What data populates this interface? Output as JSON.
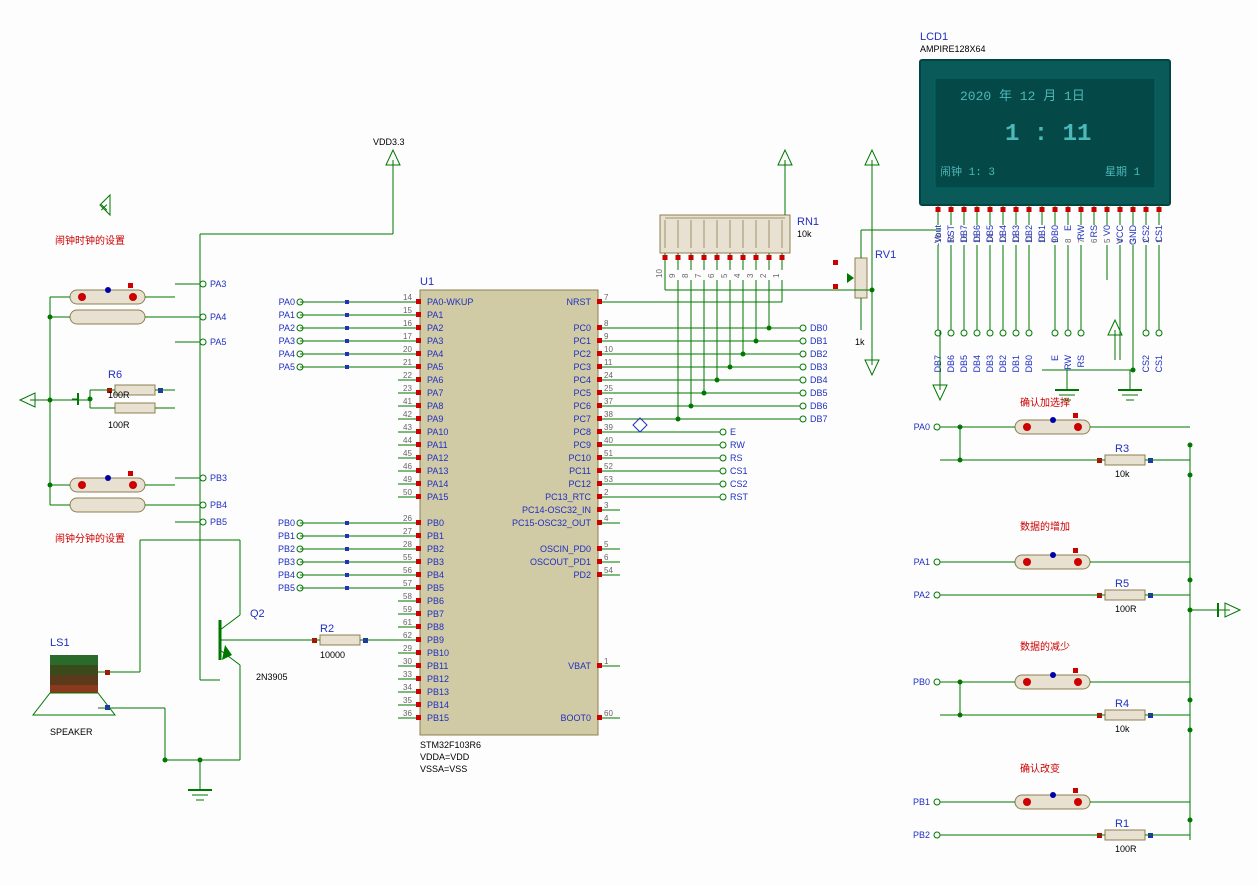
{
  "labels": {
    "section_alarm_hour": "闹钟时钟的设置",
    "section_alarm_min": "闹钟分钟的设置",
    "section_confirm_select": "确认加选择",
    "section_data_inc": "数据的增加",
    "section_data_dec": "数据的减少",
    "section_confirm_change": "确认改变",
    "vdd": "VDD3.3"
  },
  "components": {
    "U1": {
      "ref": "U1",
      "value": "STM32F103R6",
      "vdda": "VDDA=VDD",
      "vssa": "VSSA=VSS"
    },
    "LCD1": {
      "ref": "LCD1",
      "value": "AMPIRE128X64"
    },
    "RN1": {
      "ref": "RN1",
      "value": "10k"
    },
    "RV1": {
      "ref": "RV1",
      "value": "1k"
    },
    "R1": {
      "ref": "R1",
      "value": "100R"
    },
    "R2": {
      "ref": "R2",
      "value": "10000"
    },
    "R3": {
      "ref": "R3",
      "value": "10k"
    },
    "R4": {
      "ref": "R4",
      "value": "10k"
    },
    "R5": {
      "ref": "R5",
      "value": "100R"
    },
    "R6": {
      "ref": "R6",
      "value": "100R",
      "extra": "100R"
    },
    "Q2": {
      "ref": "Q2",
      "value": "2N3905"
    },
    "LS1": {
      "ref": "LS1",
      "value": "SPEAKER"
    }
  },
  "lcd_display": {
    "line1": "2020 年 12 月 1日",
    "line2": "1 : 11",
    "line3a": "闹钟 1: 3",
    "line3b": "星期 1"
  },
  "lcd_pins_top": [
    "18",
    "17",
    "16",
    "15",
    "14",
    "13",
    "12",
    "11",
    "10",
    "9",
    "8",
    "7",
    "6",
    "5",
    "4",
    "3",
    "2",
    "1"
  ],
  "lcd_pin_names": [
    "-Vout",
    "RST",
    "DB7",
    "DB6",
    "DB5",
    "DB4",
    "DB3",
    "DB2",
    "DB1",
    "DB0",
    "E",
    "RW",
    "RS",
    "V0",
    "VCC",
    "GND",
    "CS2",
    "CS1"
  ],
  "lcd_terminals": [
    "DB7",
    "DB6",
    "DB5",
    "DB4",
    "DB3",
    "DB2",
    "DB1",
    "DB0",
    "",
    "E",
    "RW",
    "RS",
    "",
    "",
    "",
    "",
    "CS2",
    "CS1"
  ],
  "rn1_pins": [
    "1",
    "2",
    "3",
    "4",
    "5",
    "6",
    "7",
    "8",
    "9",
    "10"
  ],
  "mcu_left_pins": [
    {
      "num": "14",
      "name": "PA0-WKUP"
    },
    {
      "num": "15",
      "name": "PA1"
    },
    {
      "num": "16",
      "name": "PA2"
    },
    {
      "num": "17",
      "name": "PA3"
    },
    {
      "num": "20",
      "name": "PA4"
    },
    {
      "num": "21",
      "name": "PA5"
    },
    {
      "num": "22",
      "name": "PA6"
    },
    {
      "num": "23",
      "name": "PA7"
    },
    {
      "num": "41",
      "name": "PA8"
    },
    {
      "num": "42",
      "name": "PA9"
    },
    {
      "num": "43",
      "name": "PA10"
    },
    {
      "num": "44",
      "name": "PA11"
    },
    {
      "num": "45",
      "name": "PA12"
    },
    {
      "num": "46",
      "name": "PA13"
    },
    {
      "num": "49",
      "name": "PA14"
    },
    {
      "num": "50",
      "name": "PA15"
    },
    {
      "num": "",
      "name": ""
    },
    {
      "num": "26",
      "name": "PB0"
    },
    {
      "num": "27",
      "name": "PB1"
    },
    {
      "num": "28",
      "name": "PB2"
    },
    {
      "num": "55",
      "name": "PB3"
    },
    {
      "num": "56",
      "name": "PB4"
    },
    {
      "num": "57",
      "name": "PB5"
    },
    {
      "num": "58",
      "name": "PB6"
    },
    {
      "num": "59",
      "name": "PB7"
    },
    {
      "num": "61",
      "name": "PB8"
    },
    {
      "num": "62",
      "name": "PB9"
    },
    {
      "num": "29",
      "name": "PB10"
    },
    {
      "num": "30",
      "name": "PB11"
    },
    {
      "num": "33",
      "name": "PB12"
    },
    {
      "num": "34",
      "name": "PB13"
    },
    {
      "num": "35",
      "name": "PB14"
    },
    {
      "num": "36",
      "name": "PB15"
    }
  ],
  "mcu_right_pins": [
    {
      "num": "7",
      "name": "NRST"
    },
    {
      "num": "",
      "name": ""
    },
    {
      "num": "8",
      "name": "PC0"
    },
    {
      "num": "9",
      "name": "PC1"
    },
    {
      "num": "10",
      "name": "PC2"
    },
    {
      "num": "11",
      "name": "PC3"
    },
    {
      "num": "24",
      "name": "PC4"
    },
    {
      "num": "25",
      "name": "PC5"
    },
    {
      "num": "37",
      "name": "PC6"
    },
    {
      "num": "38",
      "name": "PC7"
    },
    {
      "num": "39",
      "name": "PC8"
    },
    {
      "num": "40",
      "name": "PC9"
    },
    {
      "num": "51",
      "name": "PC10"
    },
    {
      "num": "52",
      "name": "PC11"
    },
    {
      "num": "53",
      "name": "PC12"
    },
    {
      "num": "2",
      "name": "PC13_RTC"
    },
    {
      "num": "3",
      "name": "PC14-OSC32_IN"
    },
    {
      "num": "4",
      "name": "PC15-OSC32_OUT"
    },
    {
      "num": "",
      "name": ""
    },
    {
      "num": "5",
      "name": "OSCIN_PD0"
    },
    {
      "num": "6",
      "name": "OSCOUT_PD1"
    },
    {
      "num": "54",
      "name": "PD2"
    },
    {
      "num": "",
      "name": ""
    },
    {
      "num": "",
      "name": ""
    },
    {
      "num": "",
      "name": ""
    },
    {
      "num": "",
      "name": ""
    },
    {
      "num": "",
      "name": ""
    },
    {
      "num": "",
      "name": ""
    },
    {
      "num": "1",
      "name": "VBAT"
    },
    {
      "num": "",
      "name": ""
    },
    {
      "num": "",
      "name": ""
    },
    {
      "num": "",
      "name": ""
    },
    {
      "num": "60",
      "name": "BOOT0"
    }
  ],
  "net_labels_left": [
    "PA3",
    "PA4",
    "PA5",
    "PB3",
    "PB4",
    "PB5"
  ],
  "net_labels_pa": [
    "PA0",
    "PA1",
    "PA2",
    "PA3",
    "PA4",
    "PA5"
  ],
  "net_labels_pb": [
    "PB0",
    "PB1",
    "PB2",
    "PB3",
    "PB4",
    "PB5"
  ],
  "net_labels_db": [
    "DB0",
    "DB1",
    "DB2",
    "DB3",
    "DB4",
    "DB5",
    "DB6",
    "DB7"
  ],
  "net_labels_ctrl": [
    "E",
    "RW",
    "RS",
    "CS1",
    "CS2",
    "RST"
  ],
  "btn_nets_right": [
    "PA0",
    "PA1",
    "PA2",
    "PB0",
    "PB1",
    "PB2"
  ]
}
